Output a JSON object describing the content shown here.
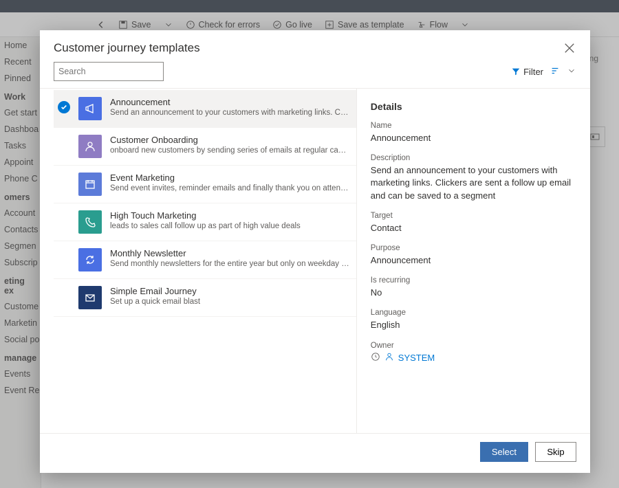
{
  "bg": {
    "cmdbar": {
      "save": "Save",
      "check": "Check for errors",
      "golive": "Go live",
      "saveas": "Save as template",
      "flow": "Flow"
    },
    "sidebar": {
      "home": "Home",
      "recent": "Recent",
      "pinned": "Pinned",
      "sec_work": "Work",
      "getstarted": "Get start",
      "dashboards": "Dashboa",
      "tasks": "Tasks",
      "appoints": "Appoint",
      "phonec": "Phone C",
      "sec_customers": "omers",
      "accounts": "Account",
      "contacts": "Contacts",
      "segments": "Segmen",
      "subscript": "Subscrip",
      "sec_exec": "eting ex",
      "custjourn": "Custome",
      "mktemails": "Marketin",
      "socialp": "Social po",
      "sec_manage": "manage",
      "events": "Events",
      "eventreg": "Event Registrations"
    },
    "right_label": "rring"
  },
  "modal": {
    "title": "Customer journey templates",
    "search_placeholder": "Search",
    "filter_label": "Filter",
    "select_btn": "Select",
    "skip_btn": "Skip"
  },
  "templates": [
    {
      "name": "Announcement",
      "desc": "Send an announcement to your customers with marketing links. Clickers are sent a follow up email",
      "color": "#4a6fe3",
      "icon": "megaphone"
    },
    {
      "name": "Customer Onboarding",
      "desc": "onboard new customers by sending series of emails at regular cadence",
      "color": "#8f7cc3",
      "icon": "person"
    },
    {
      "name": "Event Marketing",
      "desc": "Send event invites, reminder emails and finally thank you on attending",
      "color": "#5c7bd9",
      "icon": "calendar"
    },
    {
      "name": "High Touch Marketing",
      "desc": "leads to sales call follow up as part of high value deals",
      "color": "#2a9d8f",
      "icon": "phone"
    },
    {
      "name": "Monthly Newsletter",
      "desc": "Send monthly newsletters for the entire year but only on weekday afternoons",
      "color": "#4a6fe3",
      "icon": "cycle"
    },
    {
      "name": "Simple Email Journey",
      "desc": "Set up a quick email blast",
      "color": "#1f3a6e",
      "icon": "mail"
    }
  ],
  "details": {
    "heading": "Details",
    "labels": {
      "name": "Name",
      "description": "Description",
      "target": "Target",
      "purpose": "Purpose",
      "recurring": "Is recurring",
      "language": "Language",
      "owner": "Owner"
    },
    "name": "Announcement",
    "description": "Send an announcement to your customers with marketing links. Clickers are sent a follow up email and can be saved to a segment",
    "target": "Contact",
    "purpose": "Announcement",
    "recurring": "No",
    "language": "English",
    "owner": "SYSTEM"
  }
}
